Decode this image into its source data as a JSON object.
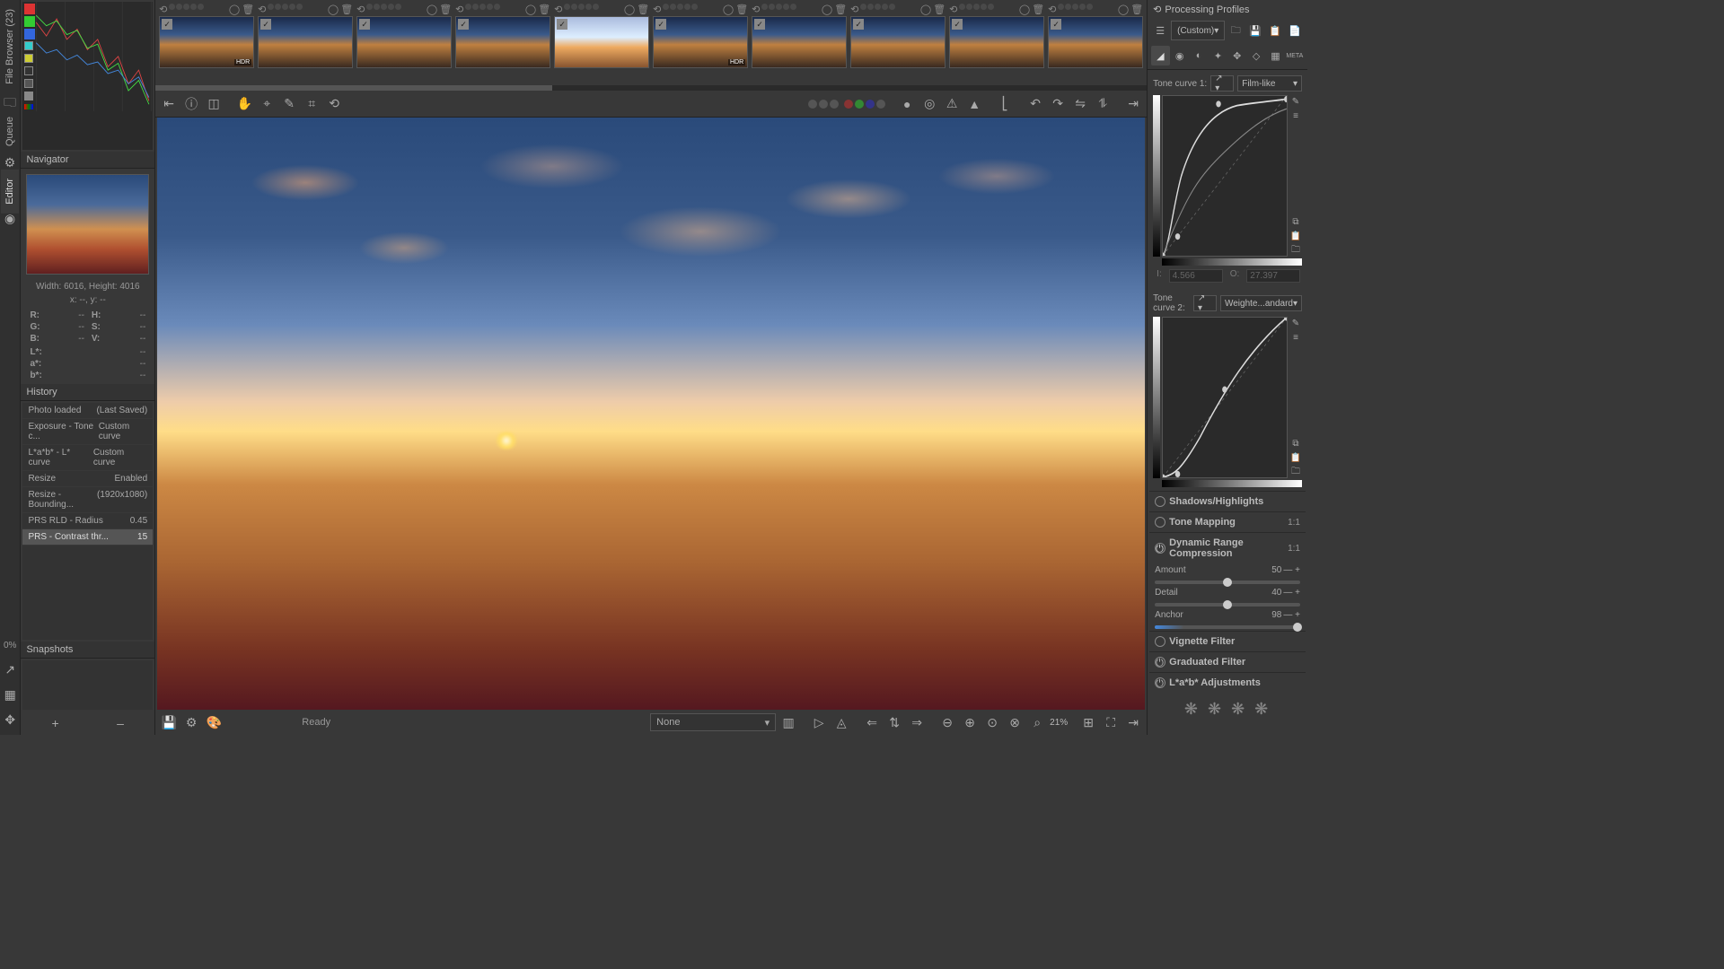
{
  "tabs": {
    "file_browser": "File Browser (23)",
    "queue": "Queue",
    "editor": "Editor"
  },
  "navigator": {
    "title": "Navigator",
    "dims": "Width: 6016, Height: 4016",
    "xy": "x: --, y: --",
    "r": "R:",
    "g": "G:",
    "b": "B:",
    "h": "H:",
    "s": "S:",
    "v": "V:",
    "lstar": "L*:",
    "astar": "a*:",
    "bstar": "b*:",
    "dash": "--"
  },
  "history": {
    "title": "History",
    "rows": [
      {
        "l": "Photo loaded",
        "r": "(Last Saved)"
      },
      {
        "l": "Exposure - Tone c...",
        "r": "Custom curve"
      },
      {
        "l": "L*a*b* - L* curve",
        "r": "Custom curve"
      },
      {
        "l": "Resize",
        "r": "Enabled"
      },
      {
        "l": "Resize - Bounding...",
        "r": "(1920x1080)"
      },
      {
        "l": "PRS RLD - Radius",
        "r": "0.45"
      },
      {
        "l": "PRS - Contrast thr...",
        "r": "15"
      }
    ]
  },
  "snapshots": {
    "title": "Snapshots",
    "plus": "+",
    "minus": "–"
  },
  "pct": "0%",
  "filmstrip": [
    {
      "hdr": "HDR",
      "bright": false
    },
    {
      "hdr": "",
      "bright": false
    },
    {
      "hdr": "",
      "bright": false
    },
    {
      "hdr": "",
      "bright": false
    },
    {
      "hdr": "",
      "bright": true
    },
    {
      "hdr": "HDR",
      "bright": false
    },
    {
      "hdr": "",
      "bright": false
    },
    {
      "hdr": "",
      "bright": false
    },
    {
      "hdr": "",
      "bright": false
    },
    {
      "hdr": "",
      "bright": false
    }
  ],
  "status": "Ready",
  "bg_select": "None",
  "zoom": "21%",
  "profiles": {
    "title": "Processing Profiles",
    "current": "(Custom)"
  },
  "curves": {
    "c1_lbl": "Tone curve 1:",
    "c1_type": "Film-like",
    "c2_lbl": "Tone curve 2:",
    "c2_type": "Weighte...andard",
    "i_lbl": "I:",
    "o_lbl": "O:",
    "i_val": "4.566",
    "o_val": "27.397"
  },
  "sections": {
    "sh": "Shadows/Highlights",
    "tm": "Tone Mapping",
    "drc": "Dynamic Range Compression",
    "vf": "Vignette Filter",
    "gf": "Graduated Filter",
    "lab": "L*a*b* Adjustments",
    "oneone": "1:1"
  },
  "drc": {
    "amount_lbl": "Amount",
    "amount_val": "50",
    "detail_lbl": "Detail",
    "detail_val": "40",
    "anchor_lbl": "Anchor",
    "anchor_val": "98"
  }
}
